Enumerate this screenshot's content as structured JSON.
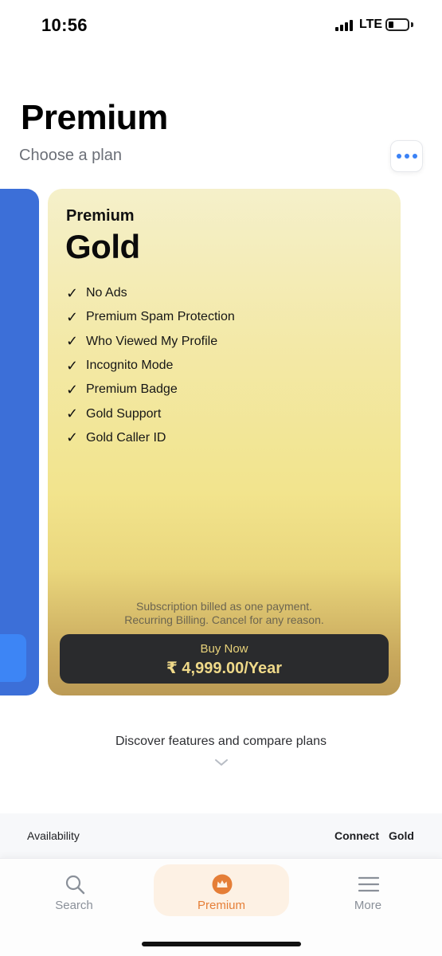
{
  "status_bar": {
    "time": "10:56",
    "network": "LTE"
  },
  "header": {
    "title": "Premium",
    "subtitle": "Choose a plan",
    "menu_icon": "more-horizontal-icon"
  },
  "plan": {
    "tier": "Premium",
    "name": "Gold",
    "features": [
      "No Ads",
      "Premium Spam Protection",
      "Who Viewed My Profile",
      "Incognito Mode",
      "Premium Badge",
      "Gold Support",
      "Gold Caller ID"
    ],
    "billing_note_line1": "Subscription billed as one payment.",
    "billing_note_line2": "Recurring Billing. Cancel for any reason.",
    "buy_label": "Buy Now",
    "price": "₹ 4,999.00/Year",
    "check_mark": "✓"
  },
  "discover": {
    "text": "Discover features and compare plans"
  },
  "compare": {
    "row_label": "Availability",
    "col1": "Connect",
    "col2": "Gold"
  },
  "tabs": [
    {
      "label": "Search",
      "icon": "search-icon"
    },
    {
      "label": "Premium",
      "icon": "crown-icon"
    },
    {
      "label": "More",
      "icon": "menu-icon"
    }
  ],
  "colors": {
    "accent": "#e57e37",
    "blue_plan": "#3c6fd8",
    "menu_dots": "#3b82f6"
  }
}
